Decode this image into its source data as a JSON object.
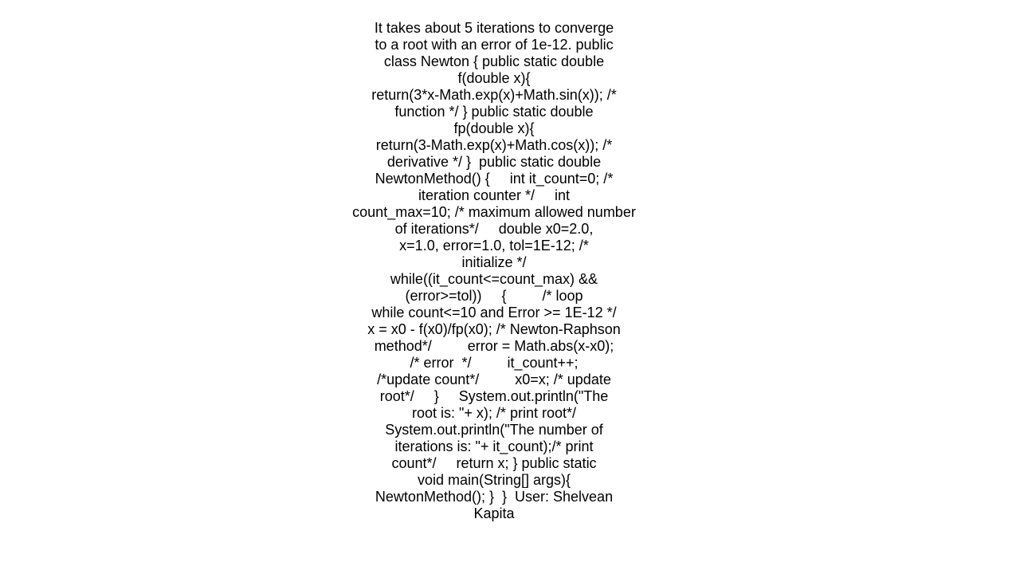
{
  "document": {
    "lines": [
      "It takes about 5 iterations to converge",
      "to a root with an error of 1e-12. public",
      "class Newton { public static double",
      "f(double x){",
      "return(3*x-Math.exp(x)+Math.sin(x)); /*",
      "function */ } public static double",
      "fp(double x){",
      "return(3-Math.exp(x)+Math.cos(x)); /*",
      "derivative */ }  public static double",
      "NewtonMethod() {     int it_count=0; /*",
      "iteration counter */     int",
      "count_max=10; /* maximum allowed number",
      "of iterations*/     double x0=2.0,",
      "x=1.0, error=1.0, tol=1E-12; /*",
      "initialize */",
      "while((it_count<=count_max) &&",
      "(error>=tol))     {         /* loop",
      "while count<=10 and Error >= 1E-12 */",
      "x = x0 - f(x0)/fp(x0); /* Newton-Raphson",
      "method*/         error = Math.abs(x-x0);",
      "/* error  */         it_count++;",
      "/*update count*/         x0=x; /* update",
      "root*/     }     System.out.println(\"The",
      "root is: \"+ x); /* print root*/",
      "System.out.println(\"The number of",
      "iterations is: \"+ it_count);/* print",
      "count*/     return x; } public static",
      "void main(String[] args){",
      "NewtonMethod(); }  }  User: Shelvean",
      "Kapita"
    ]
  }
}
